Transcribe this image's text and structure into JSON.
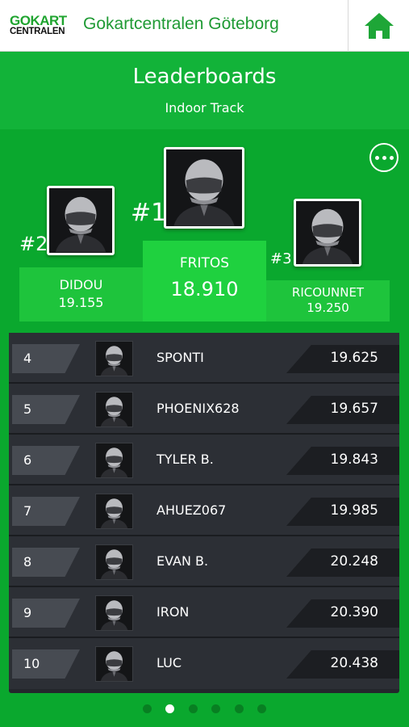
{
  "app": {
    "logo_line1": "GOKART",
    "logo_line2": "CENTRALEN",
    "title": "Gokartcentralen Göteborg",
    "home_icon": "home-icon",
    "accent_color": "#0aa82e"
  },
  "leaderboard": {
    "title": "Leaderboards",
    "subtitle": "Indoor Track",
    "more_icon": "more-options-icon"
  },
  "podium": {
    "first": {
      "rank": "#1",
      "name": "FRITOS",
      "time": "18.910"
    },
    "second": {
      "rank": "#2",
      "name": "DIDOU",
      "time": "19.155"
    },
    "third": {
      "rank": "#3",
      "name": "RICOUNNET",
      "time": "19.250"
    }
  },
  "rows": [
    {
      "pos": "4",
      "name": "SPONTI",
      "time": "19.625"
    },
    {
      "pos": "5",
      "name": "PHOENIX628",
      "time": "19.657"
    },
    {
      "pos": "6",
      "name": "TYLER B.",
      "time": "19.843"
    },
    {
      "pos": "7",
      "name": "AHUEZ067",
      "time": "19.985"
    },
    {
      "pos": "8",
      "name": "EVAN B.",
      "time": "20.248"
    },
    {
      "pos": "9",
      "name": "IRON",
      "time": "20.390"
    },
    {
      "pos": "10",
      "name": "LUC",
      "time": "20.438"
    }
  ],
  "pager": {
    "count": 6,
    "active_index": 1
  }
}
